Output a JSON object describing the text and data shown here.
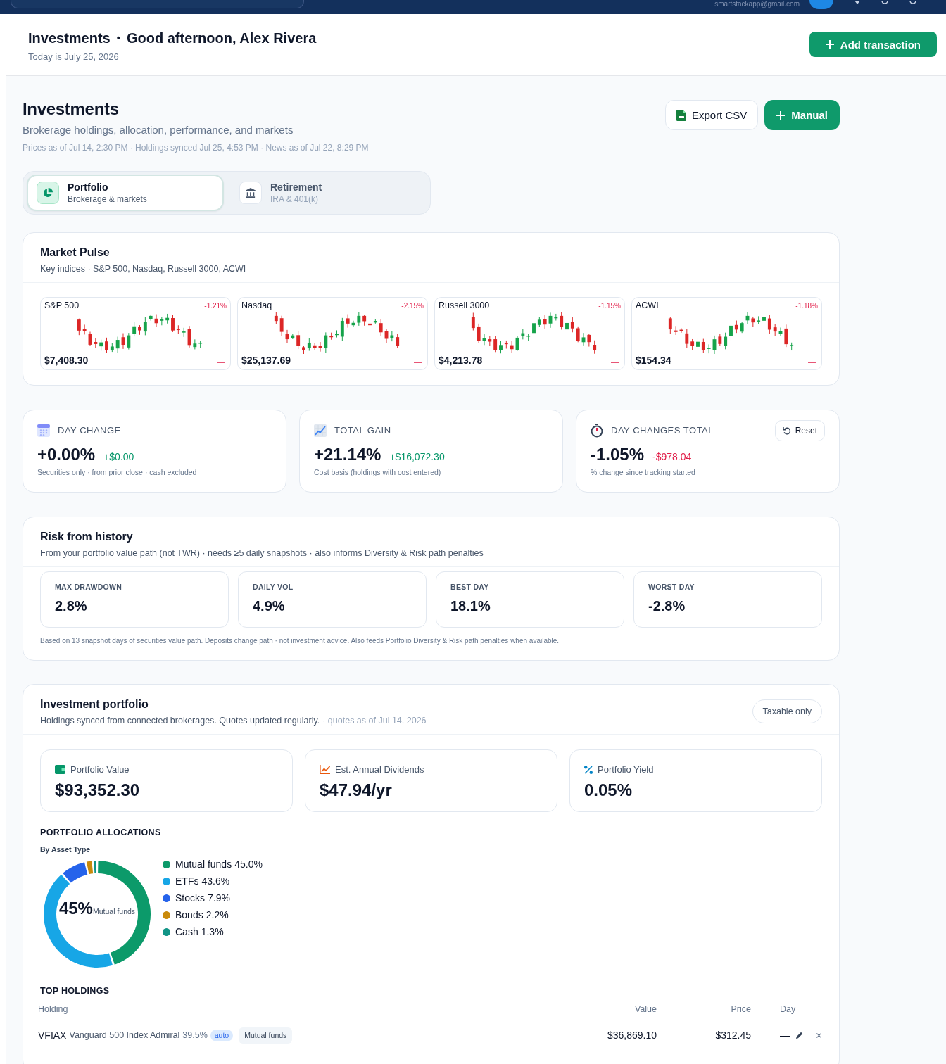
{
  "top_bar": {
    "email": "smartstackapp@gmail.com"
  },
  "header": {
    "section": "Investments",
    "separator": "•",
    "greeting": "Good afternoon, Alex Rivera",
    "date": "Today is July 25, 2026",
    "action": "Add transaction"
  },
  "page": {
    "title": "Investments",
    "subtitle": "Brokerage holdings, allocation, performance, and markets",
    "meta": "Prices as of Jul 14, 2:30 PM · Holdings synced Jul 25, 4:53 PM · News as of Jul 22, 8:29 PM",
    "buttons": [
      {
        "label": "Export CSV",
        "kind": "secondary"
      },
      {
        "label": "Manual",
        "kind": "primary"
      }
    ]
  },
  "tabs": [
    {
      "label": "Portfolio",
      "sublabel": "Brokerage & markets",
      "selected": true
    },
    {
      "label": "Retirement",
      "sublabel": "IRA & 401(k)",
      "selected": false
    }
  ],
  "market_pulse": {
    "title": "Market Pulse",
    "subtitle": "Key indices · S&P 500, Nasdaq, Russell 3000, ACWI",
    "indices": [
      {
        "name": "S&P 500",
        "change": "-1.21%",
        "negative": true,
        "price": "$7,408.30",
        "trend": "—"
      },
      {
        "name": "Nasdaq",
        "change": "-2.15%",
        "negative": true,
        "price": "$25,137.69",
        "trend": "—"
      },
      {
        "name": "Russell 3000",
        "change": "-1.15%",
        "negative": true,
        "price": "$4,213.78",
        "trend": "—"
      },
      {
        "name": "ACWI",
        "change": "-1.18%",
        "negative": true,
        "price": "$154.34",
        "trend": "—"
      }
    ]
  },
  "stats": [
    {
      "label": "DAY CHANGE",
      "value": "+0.00%",
      "delta": "+$0.00",
      "negative": false,
      "note": "Securities only · from prior close · cash excluded"
    },
    {
      "label": "TOTAL GAIN",
      "value": "+21.14%",
      "delta": "+$16,072.30",
      "negative": false,
      "note": "Cost basis (holdings with cost entered)"
    },
    {
      "label": "DAY CHANGES TOTAL",
      "value": "-1.05%",
      "delta": "-$978.04",
      "negative": true,
      "note": "% change since tracking started",
      "action": "Reset"
    }
  ],
  "risk": {
    "title": "Risk from history",
    "subtitle": "From your portfolio value path (not TWR) · needs ≥5 daily snapshots · also informs Diversity & Risk path penalties",
    "metrics": [
      {
        "label": "MAX DRAWDOWN",
        "value": "2.8%"
      },
      {
        "label": "DAILY VOL",
        "value": "4.9%"
      },
      {
        "label": "BEST DAY",
        "value": "18.1%"
      },
      {
        "label": "WORST DAY",
        "value": "-2.8%"
      }
    ],
    "footnote": "Based on 13 snapshot days of securities value path. Deposits change path · not investment advice. Also feeds Portfolio Diversity & Risk path penalties when available."
  },
  "portfolio": {
    "title": "Investment portfolio",
    "subtitle": "Holdings synced from connected brokerages. Quotes updated regularly.",
    "quotes_note": "· quotes as of Jul 14, 2026",
    "filter": "Taxable only",
    "metrics": [
      {
        "label": "Portfolio Value",
        "value": "$93,352.30"
      },
      {
        "label": "Est. Annual Dividends",
        "value": "$47.94/yr"
      },
      {
        "label": "Portfolio Yield",
        "value": "0.05%"
      }
    ],
    "allocations": {
      "title": "PORTFOLIO ALLOCATIONS",
      "subtitle": "By Asset Type",
      "center_value": "45%",
      "center_label": "Mutual funds",
      "legend": [
        {
          "share": "45.0%",
          "color": "#0c9a6a"
        },
        {
          "share": "43.6%",
          "color": "#17a6e6"
        },
        {
          "share": "7.9%",
          "color": "#2563eb"
        },
        {
          "share": "2.2%",
          "color": "#c98a0a"
        },
        {
          "share": "1.3%",
          "color": "#119486"
        }
      ],
      "chart_data": {
        "type": "donut",
        "categories": [
          "Mutual funds",
          "ETFs",
          "Stocks",
          "Bonds",
          "Cash"
        ],
        "values": [
          45.0,
          43.6,
          7.9,
          2.2,
          1.3
        ]
      }
    },
    "holdings": {
      "title": "TOP HOLDINGS",
      "columns": [
        "Holding",
        "Value",
        "Price",
        "Day"
      ],
      "rows": [
        {
          "ticker": "VFIAX",
          "name": "Vanguard 500 Index Admiral",
          "weight": "39.5%",
          "source": "auto",
          "asset_type": "Mutual funds",
          "value": "$36,869.10",
          "price": "$312.45",
          "day": "—"
        }
      ]
    }
  }
}
